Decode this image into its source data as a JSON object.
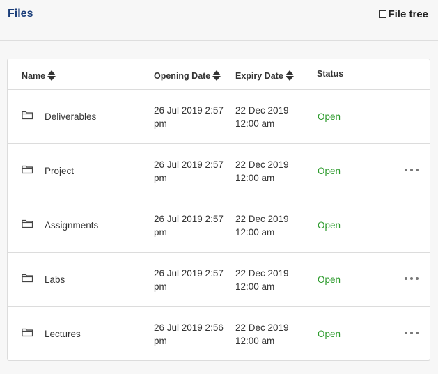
{
  "header": {
    "title": "Files",
    "file_tree_label": "File tree"
  },
  "table": {
    "columns": {
      "name": "Name",
      "opening_date": "Opening Date",
      "expiry_date": "Expiry Date",
      "status": "Status"
    },
    "rows": [
      {
        "name": "Deliverables",
        "opening_line1": "26 Jul 2019 2:57",
        "opening_line2": "pm",
        "expiry_line1": "22 Dec 2019",
        "expiry_line2": "12:00 am",
        "status": "Open",
        "has_menu": false
      },
      {
        "name": "Project",
        "opening_line1": "26 Jul 2019 2:57",
        "opening_line2": "pm",
        "expiry_line1": "22 Dec 2019",
        "expiry_line2": "12:00 am",
        "status": "Open",
        "has_menu": true
      },
      {
        "name": "Assignments",
        "opening_line1": "26 Jul 2019 2:57",
        "opening_line2": "pm",
        "expiry_line1": "22 Dec 2019",
        "expiry_line2": "12:00 am",
        "status": "Open",
        "has_menu": false
      },
      {
        "name": "Labs",
        "opening_line1": "26 Jul 2019 2:57",
        "opening_line2": "pm",
        "expiry_line1": "22 Dec 2019",
        "expiry_line2": "12:00 am",
        "status": "Open",
        "has_menu": true
      },
      {
        "name": "Lectures",
        "opening_line1": "26 Jul 2019 2:56",
        "opening_line2": "pm",
        "expiry_line1": "22 Dec 2019",
        "expiry_line2": "12:00 am",
        "status": "Open",
        "has_menu": true
      }
    ]
  },
  "colors": {
    "title": "#1b3e7a",
    "status_open": "#2b9a2b"
  },
  "icons": {
    "folder": "folder-icon",
    "sort": "sort-icon",
    "menu": "more-options-icon"
  }
}
